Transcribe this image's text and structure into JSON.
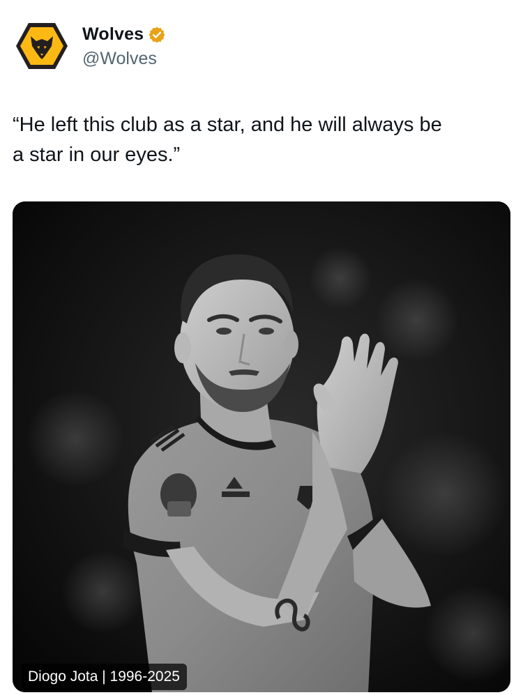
{
  "account": {
    "display_name": "Wolves",
    "handle": "@Wolves",
    "verified": true,
    "avatar_icon": "wolf-head-logo-icon",
    "badge_icon": "verified-badge-icon",
    "badge_color": "#e8a317"
  },
  "tweet": {
    "text": "“He left this club as a star, and he will always be\na star in our eyes.”"
  },
  "media": {
    "type": "black-and-white photograph",
    "caption": "Diogo Jota | 1996-2025"
  },
  "colors": {
    "brand_gold": "#fdb913",
    "brand_black": "#231f20",
    "text_primary": "#0f1419",
    "text_secondary": "#536471"
  }
}
